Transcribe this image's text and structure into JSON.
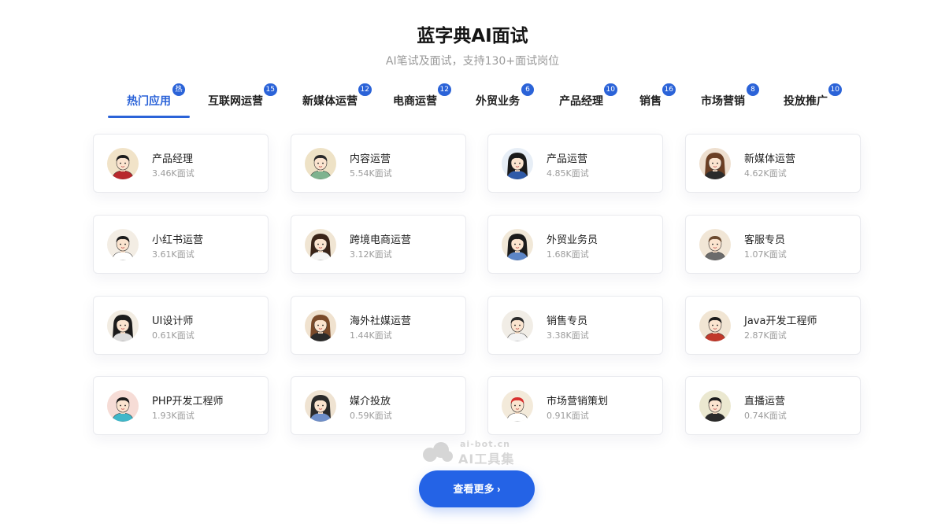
{
  "header": {
    "title": "蓝字典AI面试",
    "subtitle": "AI笔试及面试，支持130+面试岗位"
  },
  "tabs": [
    {
      "label": "热门应用",
      "badge": "热",
      "active": true
    },
    {
      "label": "互联网运营",
      "badge": "15"
    },
    {
      "label": "新媒体运营",
      "badge": "12"
    },
    {
      "label": "电商运营",
      "badge": "12"
    },
    {
      "label": "外贸业务",
      "badge": "6"
    },
    {
      "label": "产品经理",
      "badge": "10"
    },
    {
      "label": "销售",
      "badge": "16"
    },
    {
      "label": "市场营销",
      "badge": "8"
    },
    {
      "label": "投放推广",
      "badge": "10"
    }
  ],
  "cards": [
    {
      "title": "产品经理",
      "count": "3.46K面试",
      "avatar_bg": "#f1e3c8",
      "hair": "#1c1c1c",
      "shirt": "#b8292d",
      "long_hair": false
    },
    {
      "title": "内容运营",
      "count": "5.54K面试",
      "avatar_bg": "#eee2c6",
      "hair": "#2a2a2a",
      "shirt": "#7fb38f",
      "long_hair": false
    },
    {
      "title": "产品运营",
      "count": "4.85K面试",
      "avatar_bg": "#e7eef6",
      "hair": "#1a1a1a",
      "shirt": "#2f5aa8",
      "long_hair": true
    },
    {
      "title": "新媒体运营",
      "count": "4.62K面试",
      "avatar_bg": "#eedfcf",
      "hair": "#6b3f24",
      "shirt": "#2b2b2b",
      "long_hair": true
    },
    {
      "title": "小红书运营",
      "count": "3.61K面试",
      "avatar_bg": "#f3ede4",
      "hair": "#1c1c1c",
      "shirt": "#ffffff",
      "long_hair": false
    },
    {
      "title": "跨境电商运营",
      "count": "3.12K面试",
      "avatar_bg": "#f0e5d3",
      "hair": "#3a2418",
      "shirt": "#f5f5f5",
      "long_hair": true
    },
    {
      "title": "外贸业务员",
      "count": "1.68K面试",
      "avatar_bg": "#f1e8d8",
      "hair": "#1c1c1c",
      "shirt": "#5d86c7",
      "long_hair": true
    },
    {
      "title": "客服专员",
      "count": "1.07K面试",
      "avatar_bg": "#f1e6d6",
      "hair": "#6b4a2f",
      "shirt": "#6b6b6b",
      "long_hair": false
    },
    {
      "title": "UI设计师",
      "count": "0.61K面试",
      "avatar_bg": "#f2ece2",
      "hair": "#1c1c1c",
      "shirt": "#dcdcdc",
      "long_hair": true
    },
    {
      "title": "海外社媒运营",
      "count": "1.44K面试",
      "avatar_bg": "#f0e2cf",
      "hair": "#7a4a2a",
      "shirt": "#2a2a2a",
      "long_hair": true
    },
    {
      "title": "销售专员",
      "count": "3.38K面试",
      "avatar_bg": "#f1ede6",
      "hair": "#2a2a2a",
      "shirt": "#f3f3f3",
      "long_hair": false
    },
    {
      "title": "Java开发工程师",
      "count": "2.87K面试",
      "avatar_bg": "#f1e5d3",
      "hair": "#1c1c1c",
      "shirt": "#c0392b",
      "long_hair": false
    },
    {
      "title": "PHP开发工程师",
      "count": "1.93K面试",
      "avatar_bg": "#f6dcd6",
      "hair": "#1c1c1c",
      "shirt": "#3fb7c9",
      "long_hair": false
    },
    {
      "title": "媒介投放",
      "count": "0.59K面试",
      "avatar_bg": "#efe3d2",
      "hair": "#2a2a2a",
      "shirt": "#6f8fc9",
      "long_hair": true
    },
    {
      "title": "市场营销策划",
      "count": "0.91K面试",
      "avatar_bg": "#f3eada",
      "hair": "#d8312f",
      "shirt": "#ffffff",
      "long_hair": false
    },
    {
      "title": "直播运营",
      "count": "0.74K面试",
      "avatar_bg": "#ebe8d0",
      "hair": "#1c1c1c",
      "shirt": "#2a2a2a",
      "long_hair": false
    }
  ],
  "watermark": {
    "domain": "ai-bot.cn",
    "name": "AI工具集"
  },
  "more_button": {
    "label": "查看更多 ›"
  }
}
